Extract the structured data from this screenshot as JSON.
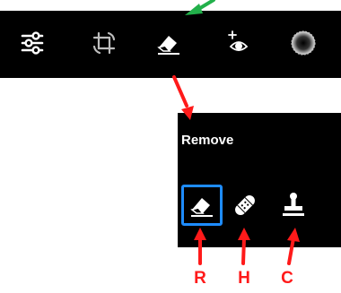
{
  "toolbar": {
    "tools": [
      {
        "icon": "sliders-icon"
      },
      {
        "icon": "crop-rotate-icon"
      },
      {
        "icon": "eraser-icon"
      },
      {
        "icon": "red-eye-icon"
      },
      {
        "icon": "vignette-icon"
      }
    ]
  },
  "panel": {
    "title": "Remove",
    "tools": [
      {
        "icon": "eraser-icon",
        "selected": true
      },
      {
        "icon": "bandage-icon",
        "selected": false
      },
      {
        "icon": "clone-stamp-icon",
        "selected": false
      }
    ]
  },
  "annotations": {
    "labels": [
      "R",
      "H",
      "C"
    ],
    "colors": {
      "pointer": "#ff1a1a",
      "highlight": "#1e8cff",
      "top_arrow": "#22b04a"
    }
  }
}
